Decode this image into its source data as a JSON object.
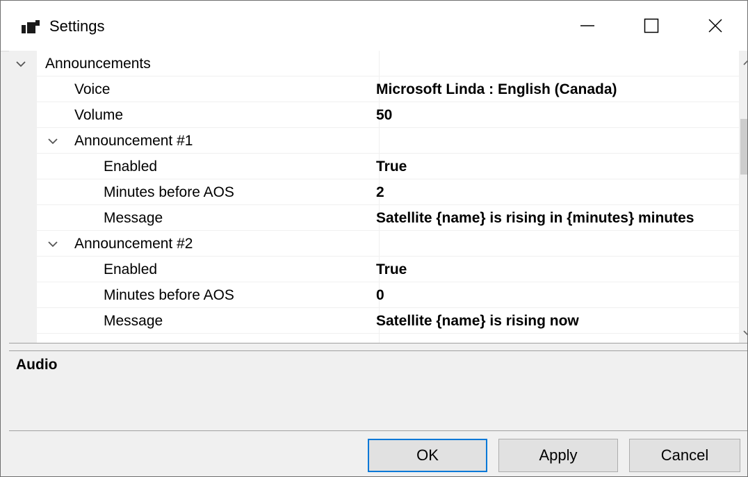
{
  "window": {
    "title": "Settings"
  },
  "grid": {
    "rows": [
      {
        "type": "category",
        "name": "Announcements",
        "value": ""
      },
      {
        "type": "prop",
        "name": "Voice",
        "value": "Microsoft Linda : English (Canada)"
      },
      {
        "type": "prop",
        "name": "Volume",
        "value": "50"
      },
      {
        "type": "group",
        "name": "Announcement #1",
        "value": ""
      },
      {
        "type": "subprop",
        "name": "Enabled",
        "value": "True"
      },
      {
        "type": "subprop",
        "name": "Minutes before AOS",
        "value": "2"
      },
      {
        "type": "subprop",
        "name": "Message",
        "value": "Satellite {name} is rising in {minutes} minutes"
      },
      {
        "type": "group",
        "name": "Announcement #2",
        "value": ""
      },
      {
        "type": "subprop",
        "name": "Enabled",
        "value": "True"
      },
      {
        "type": "subprop",
        "name": "Minutes before AOS",
        "value": "0"
      },
      {
        "type": "subprop",
        "name": "Message",
        "value": "Satellite {name} is rising now"
      }
    ]
  },
  "description": {
    "title": "Audio"
  },
  "buttons": {
    "ok": "OK",
    "apply": "Apply",
    "cancel": "Cancel"
  }
}
